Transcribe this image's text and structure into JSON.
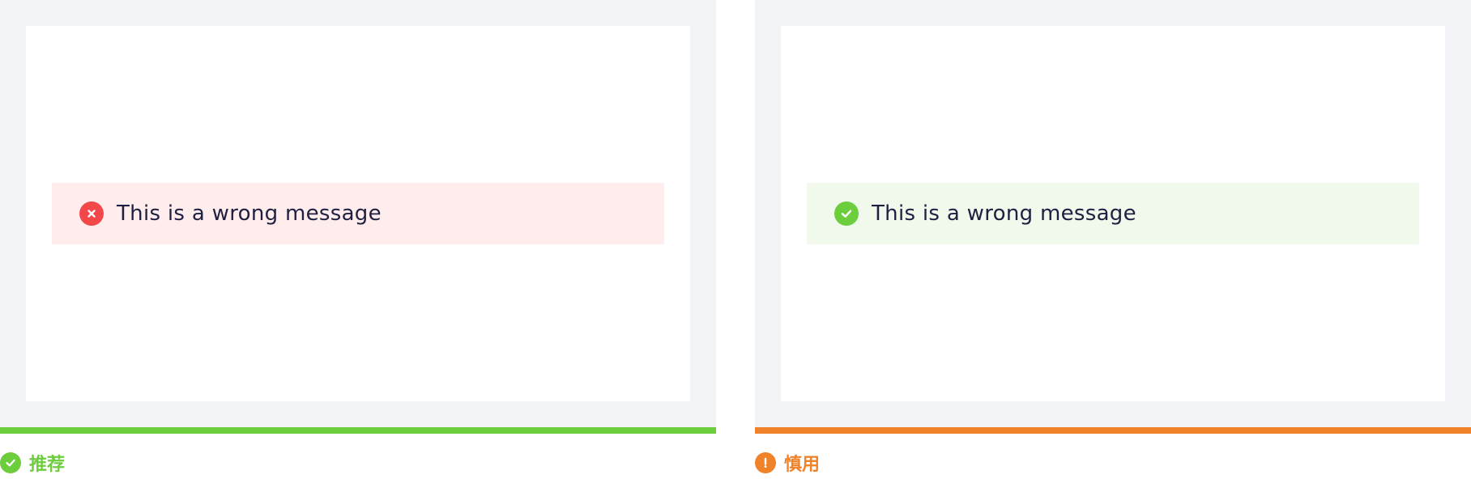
{
  "colors": {
    "frame_bg": "#f3f4f7",
    "error_red": "#f4474a",
    "error_bg": "#ffeded",
    "success_green": "#6ccd3d",
    "success_bg": "#f0f9eb",
    "caution_orange": "#f0832a",
    "text_dark": "#1f2041"
  },
  "left_panel": {
    "message": {
      "icon": "error-x-icon",
      "text": "This is a wrong message"
    },
    "verdict": {
      "icon": "check-circle-icon",
      "label": "推荐"
    }
  },
  "right_panel": {
    "message": {
      "icon": "success-check-icon",
      "text": "This is a wrong message"
    },
    "verdict": {
      "icon": "exclamation-circle-icon",
      "label": "慎用"
    }
  }
}
